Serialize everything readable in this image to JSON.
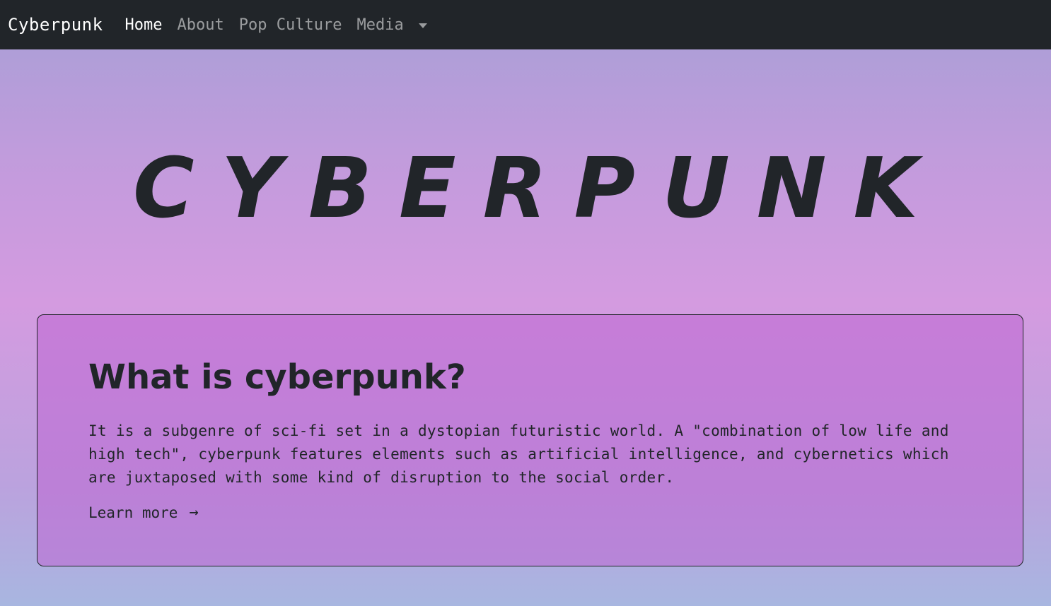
{
  "navbar": {
    "brand": "Cyberpunk",
    "links": [
      {
        "label": "Home",
        "active": true
      },
      {
        "label": "About",
        "active": false
      },
      {
        "label": "Pop Culture",
        "active": false
      },
      {
        "label": "Media",
        "active": false
      }
    ],
    "dropdown_icon": "caret-down-icon",
    "background": "#212529"
  },
  "hero": {
    "title": "CYBERPUNK"
  },
  "card": {
    "heading": "What is cyberpunk?",
    "body": "It is a subgenre of sci-fi set in a dystopian futuristic world. A \"combination of low life and high tech\", cyberpunk features elements such as artificial intelligence, and cybernetics which are juxtaposed with some kind of disruption to the social order.",
    "link_label": "Learn more",
    "link_icon": "→",
    "background": "#c36fd4"
  }
}
